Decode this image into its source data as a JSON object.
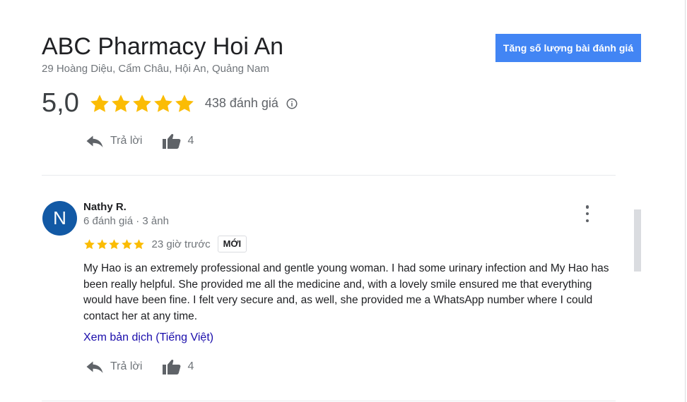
{
  "business": {
    "name": "ABC Pharmacy Hoi An",
    "address": "29 Hoàng Diệu, Cẩm Châu, Hội An, Quảng Nam",
    "rating": "5,0",
    "stars": 5,
    "review_count_label": "438 đánh giá"
  },
  "cta": {
    "label": "Tăng số lượng bài đánh giá"
  },
  "previous_review_actions": {
    "reply_label": "Trả lời",
    "like_count": "4"
  },
  "review": {
    "avatar_letter": "N",
    "name": "Nathy R.",
    "meta": "6 đánh giá · 3 ảnh",
    "stars": 5,
    "time": "23 giờ trước",
    "badge": "MỚI",
    "text": "My Hao is an extremely professional and gentle young woman. I had some urinary infection and My Hao has been really helpful. She provided me all the medicine and, with a lovely smile ensured me that everything would have been fine. I felt very secure and, as well, she provided me a WhatsApp number where I could contact her at any time.",
    "translate_link": "Xem bản dịch (Tiếng Việt)",
    "reply_label": "Trả lời",
    "like_count": "4"
  },
  "colors": {
    "accent": "#4285f4",
    "star": "#fbbc04",
    "avatar": "#1259a5",
    "link": "#1a0dab",
    "muted": "#70757a"
  }
}
